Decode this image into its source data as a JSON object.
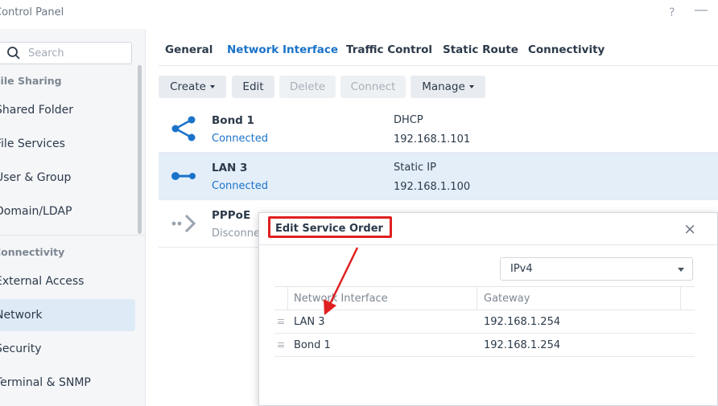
{
  "window": {
    "title": "Control Panel",
    "help_glyph": "?",
    "minimize_glyph": "—"
  },
  "sidebar": {
    "search_placeholder": "Search",
    "sections": [
      {
        "header": "File Sharing",
        "items": [
          "Shared Folder",
          "File Services",
          "User & Group",
          "Domain/LDAP"
        ]
      },
      {
        "header": "Connectivity",
        "items": [
          "External Access",
          "Network",
          "Security",
          "Terminal & SNMP"
        ]
      }
    ],
    "active_item": "Network"
  },
  "tabs": [
    "General",
    "Network Interface",
    "Traffic Control",
    "Static Route",
    "Connectivity"
  ],
  "active_tab": "Network Interface",
  "toolbar": {
    "create": "Create",
    "edit": "Edit",
    "delete": "Delete",
    "connect": "Connect",
    "manage": "Manage"
  },
  "interfaces": [
    {
      "name": "Bond 1",
      "status": "Connected",
      "mode": "DHCP",
      "ip": "192.168.1.101",
      "icon": "bond-icon"
    },
    {
      "name": "LAN 3",
      "status": "Connected",
      "mode": "Static IP",
      "ip": "192.168.1.100",
      "icon": "lan-icon",
      "selected": true
    },
    {
      "name": "PPPoE",
      "status": "Disconne",
      "mode": "",
      "ip": "",
      "icon": "pppoe-icon"
    }
  ],
  "dialog": {
    "title": "Edit Service Order",
    "close_glyph": "×",
    "ip_version": "IPv4",
    "columns": [
      "Network Interface",
      "Gateway"
    ],
    "rows": [
      {
        "interface": "LAN 3",
        "gateway": "192.168.1.254"
      },
      {
        "interface": "Bond 1",
        "gateway": "192.168.1.254"
      }
    ]
  },
  "colors": {
    "accent": "#1a73c9",
    "annotation": "#e02020",
    "selected_row": "#e4eef9"
  }
}
